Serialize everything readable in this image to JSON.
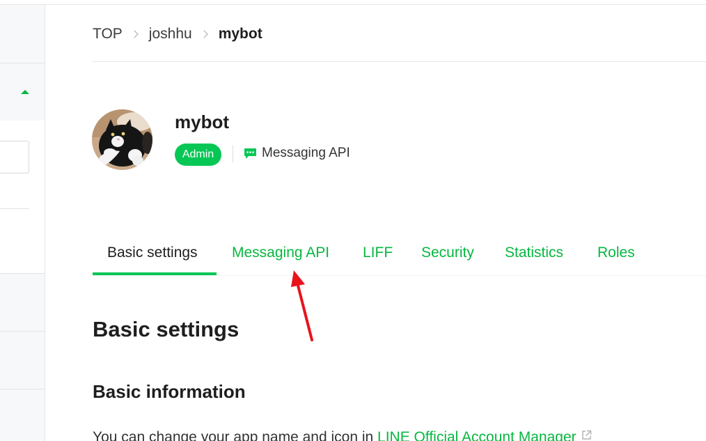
{
  "breadcrumb": {
    "items": [
      "TOP",
      "joshhu"
    ],
    "current": "mybot"
  },
  "channel": {
    "name": "mybot",
    "role_badge": "Admin",
    "type": "Messaging API",
    "type_icon": "chat-bubble-icon",
    "avatar": "cat-avatar"
  },
  "tabs": [
    {
      "label": "Basic settings",
      "active": true
    },
    {
      "label": "Messaging API",
      "active": false
    },
    {
      "label": "LIFF",
      "active": false
    },
    {
      "label": "Security",
      "active": false
    },
    {
      "label": "Statistics",
      "active": false
    },
    {
      "label": "Roles",
      "active": false
    }
  ],
  "content": {
    "heading": "Basic settings",
    "section_heading": "Basic information",
    "description_prefix": "You can change your app name and icon in ",
    "description_link": "LINE Official Account Manager",
    "link_icon": "external-link-icon"
  },
  "colors": {
    "accent_green": "#06c755",
    "link_green": "#06b73f",
    "annotation_red": "#e8141b"
  }
}
